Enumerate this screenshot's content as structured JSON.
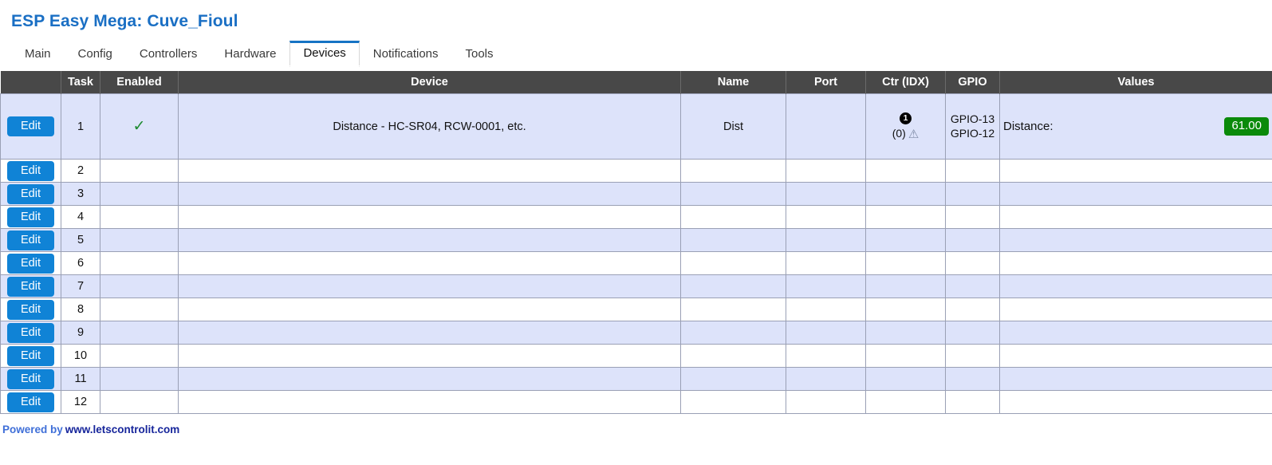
{
  "header": {
    "title": "ESP Easy Mega: Cuve_Fioul"
  },
  "tabs": [
    {
      "label": "Main",
      "active": false
    },
    {
      "label": "Config",
      "active": false
    },
    {
      "label": "Controllers",
      "active": false
    },
    {
      "label": "Hardware",
      "active": false
    },
    {
      "label": "Devices",
      "active": true
    },
    {
      "label": "Notifications",
      "active": false
    },
    {
      "label": "Tools",
      "active": false
    }
  ],
  "table": {
    "columns": [
      "",
      "Task",
      "Enabled",
      "Device",
      "Name",
      "Port",
      "Ctr (IDX)",
      "GPIO",
      "Values"
    ],
    "edit_label": "Edit",
    "enabled_check": "✓",
    "rows": [
      {
        "task": "1",
        "enabled": true,
        "device": "Distance - HC-SR04, RCW-0001, etc.",
        "name": "Dist",
        "port": "",
        "ctr_badge": "1",
        "ctr_idx": "(0)",
        "ctr_warn": "⚠",
        "gpio": "GPIO-13 GPIO-12",
        "value_label": "Distance:",
        "value": "61.00"
      },
      {
        "task": "2",
        "enabled": false,
        "device": "",
        "name": "",
        "port": "",
        "gpio": "",
        "value_label": "",
        "value": ""
      },
      {
        "task": "3",
        "enabled": false,
        "device": "",
        "name": "",
        "port": "",
        "gpio": "",
        "value_label": "",
        "value": ""
      },
      {
        "task": "4",
        "enabled": false,
        "device": "",
        "name": "",
        "port": "",
        "gpio": "",
        "value_label": "",
        "value": ""
      },
      {
        "task": "5",
        "enabled": false,
        "device": "",
        "name": "",
        "port": "",
        "gpio": "",
        "value_label": "",
        "value": ""
      },
      {
        "task": "6",
        "enabled": false,
        "device": "",
        "name": "",
        "port": "",
        "gpio": "",
        "value_label": "",
        "value": ""
      },
      {
        "task": "7",
        "enabled": false,
        "device": "",
        "name": "",
        "port": "",
        "gpio": "",
        "value_label": "",
        "value": ""
      },
      {
        "task": "8",
        "enabled": false,
        "device": "",
        "name": "",
        "port": "",
        "gpio": "",
        "value_label": "",
        "value": ""
      },
      {
        "task": "9",
        "enabled": false,
        "device": "",
        "name": "",
        "port": "",
        "gpio": "",
        "value_label": "",
        "value": ""
      },
      {
        "task": "10",
        "enabled": false,
        "device": "",
        "name": "",
        "port": "",
        "gpio": "",
        "value_label": "",
        "value": ""
      },
      {
        "task": "11",
        "enabled": false,
        "device": "",
        "name": "",
        "port": "",
        "gpio": "",
        "value_label": "",
        "value": ""
      },
      {
        "task": "12",
        "enabled": false,
        "device": "",
        "name": "",
        "port": "",
        "gpio": "",
        "value_label": "",
        "value": ""
      }
    ]
  },
  "footer": {
    "powered_by": "Powered by",
    "link": "www.letscontrolit.com"
  },
  "colors": {
    "title": "#1a6fc4",
    "tab_accent": "#1673c4",
    "header_bg": "#484848",
    "row_alt_bg": "#dde3fa",
    "edit_button": "#1083d6",
    "value_badge": "#0a8a0a",
    "check": "#1c8a2e",
    "footer_link": "#16259b"
  }
}
